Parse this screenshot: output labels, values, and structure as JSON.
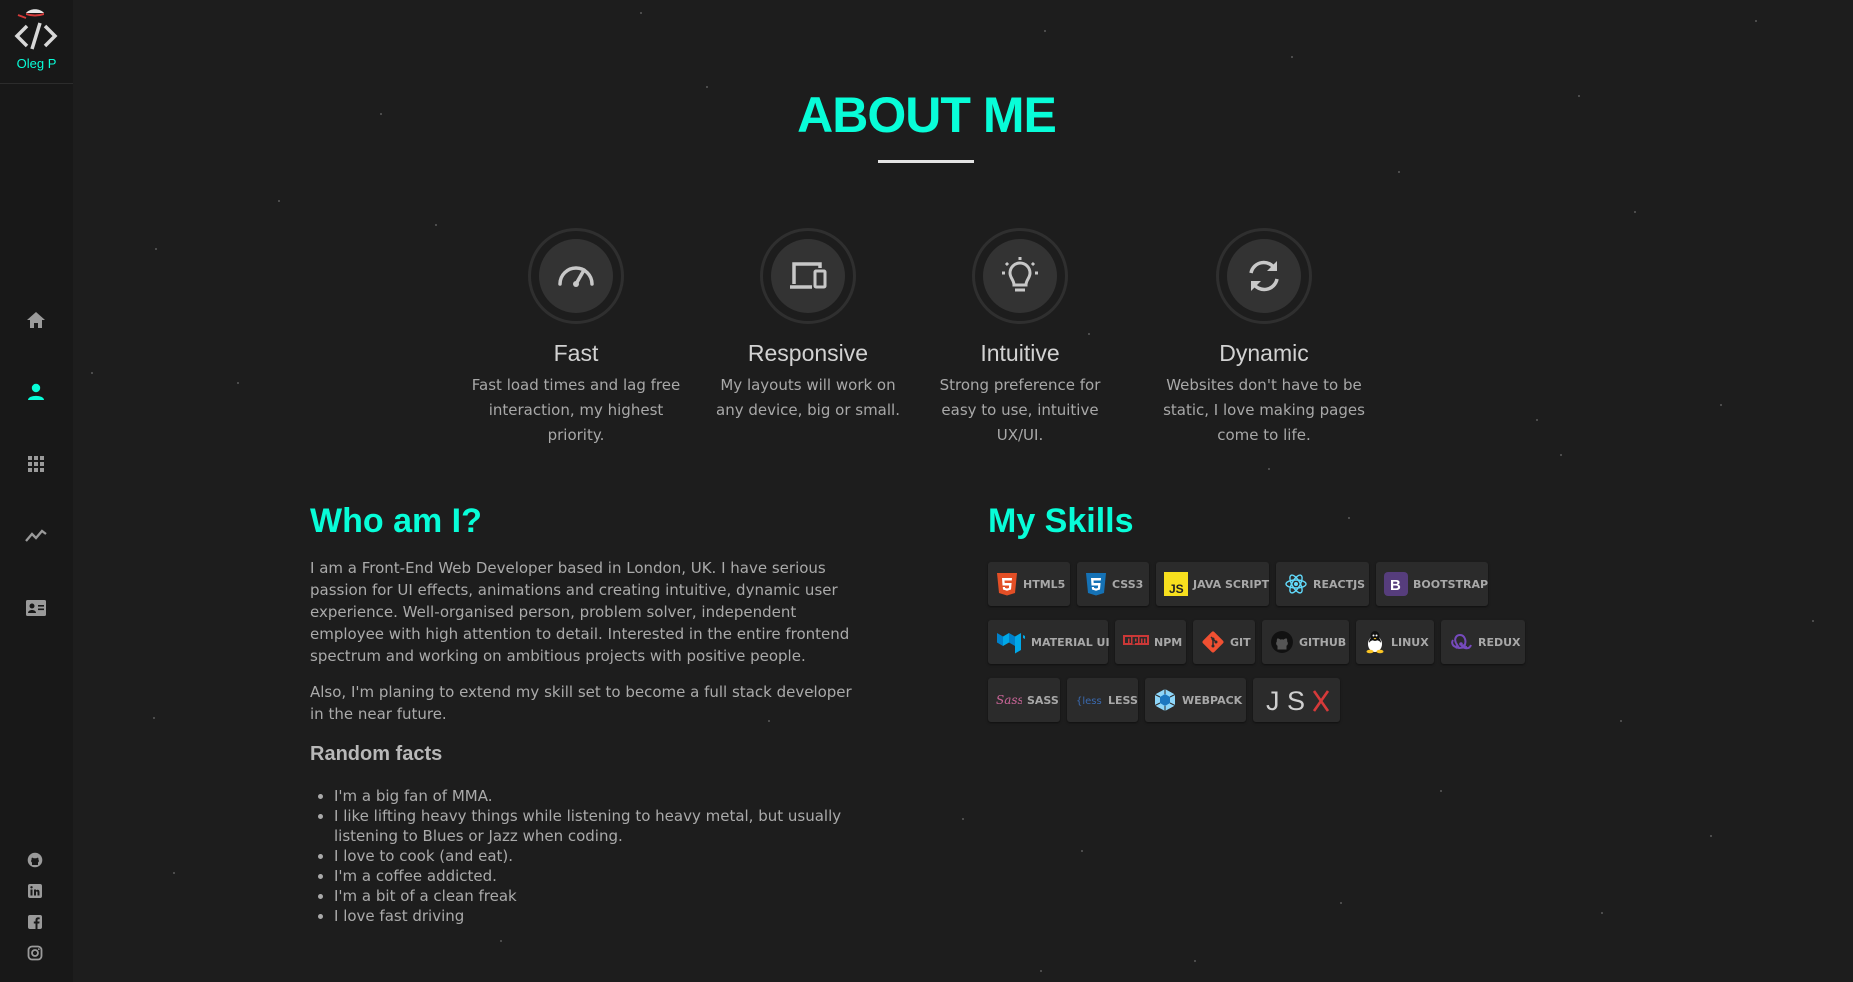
{
  "brand": {
    "name": "Oleg P"
  },
  "nav": {
    "items": [
      "home",
      "about",
      "portfolio",
      "skills",
      "contact"
    ],
    "active": "about",
    "active_color": "#08fdd8",
    "icon_color": "#9a9a9a"
  },
  "social": [
    "github",
    "linkedin",
    "facebook",
    "instagram"
  ],
  "page": {
    "title": "ABOUT ME"
  },
  "features": [
    {
      "icon": "speedometer-icon",
      "title": "Fast",
      "desc": "Fast load times and lag free interaction, my highest priority."
    },
    {
      "icon": "devices-icon",
      "title": "Responsive",
      "desc": "My layouts will work on any device, big or small."
    },
    {
      "icon": "lightbulb-icon",
      "title": "Intuitive",
      "desc": "Strong preference for easy to use, intuitive UX/UI."
    },
    {
      "icon": "refresh-icon",
      "title": "Dynamic",
      "desc": "Websites don't have to be static, I love making pages come to life."
    }
  ],
  "who": {
    "heading": "Who am I?",
    "p1": "I am a Front-End Web Developer based in London, UK. I have serious passion for UI effects, animations and creating intuitive, dynamic user experience. Well-organised person, problem solver, independent employee with high attention to detail. Interested in the entire frontend spectrum and working on ambitious projects with positive people.",
    "p2": "Also, I'm planing to extend my skill set to become a full stack developer in the near future.",
    "facts_heading": "Random facts",
    "facts": [
      "I'm a big fan of MMA.",
      "I like lifting heavy things while listening to heavy metal, but usually listening to Blues or Jazz when coding.",
      "I love to cook (and eat).",
      "I'm a coffee addicted.",
      "I'm a bit of a clean freak",
      "I love fast driving"
    ]
  },
  "skills": {
    "heading": "My Skills",
    "badges": [
      {
        "label": "HTML5",
        "icon": "html5-icon",
        "color": "#e34f26"
      },
      {
        "label": "CSS3",
        "icon": "css3-icon",
        "color": "#1572b6"
      },
      {
        "label": "JAVA SCRIPT",
        "icon": "javascript-icon",
        "color": "#f7df1e"
      },
      {
        "label": "REACTJS",
        "icon": "react-icon",
        "color": "#61dafb"
      },
      {
        "label": "BOOTSTRAP",
        "icon": "bootstrap-icon",
        "color": "#563d7c"
      },
      {
        "label": "MATERIAL UI",
        "icon": "material-ui-icon",
        "color": "#0081cb"
      },
      {
        "label": "NPM",
        "icon": "npm-icon",
        "color": "#cb3837"
      },
      {
        "label": "GIT",
        "icon": "git-icon",
        "color": "#f05032"
      },
      {
        "label": "GITHUB",
        "icon": "github-icon",
        "color": "#181717"
      },
      {
        "label": "LINUX",
        "icon": "linux-icon",
        "color": "#fcc624"
      },
      {
        "label": "REDUX",
        "icon": "redux-icon",
        "color": "#764abc"
      },
      {
        "label": "SASS",
        "icon": "sass-icon",
        "color": "#cc6699"
      },
      {
        "label": "LESS",
        "icon": "less-icon",
        "color": "#1d365d"
      },
      {
        "label": "WEBPACK",
        "icon": "webpack-icon",
        "color": "#8dd6f9"
      },
      {
        "label": "JSX",
        "icon": "jsx-icon",
        "color": "#e0e0e0"
      }
    ]
  }
}
